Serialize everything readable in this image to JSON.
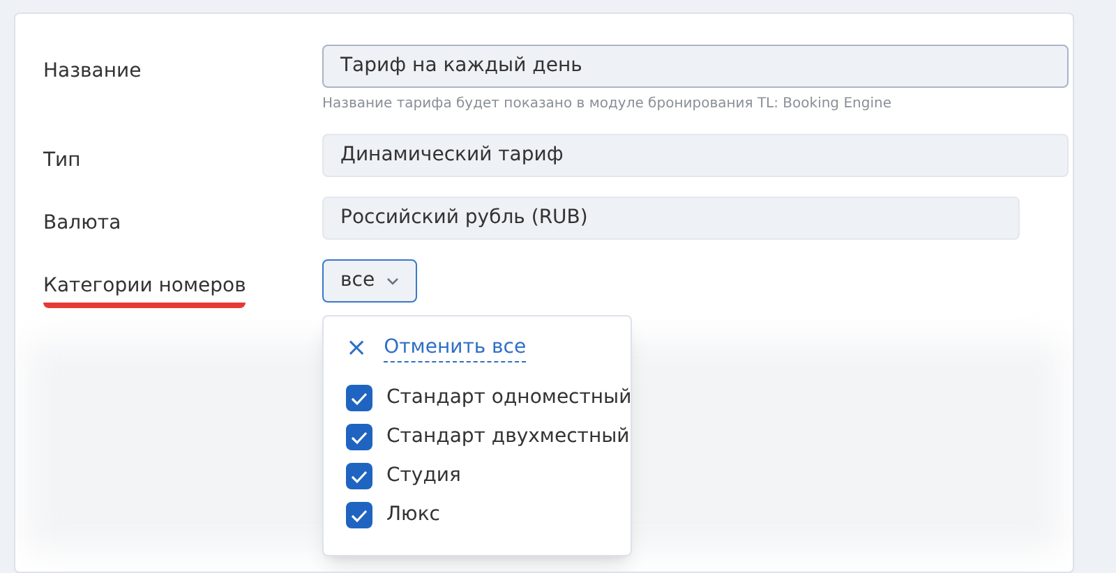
{
  "fields": [
    {
      "kind": "text",
      "label": "Название",
      "value": "Тариф на каждый день",
      "hint": "Название тарифа будет показано в модуле бронирования TL: Booking Engine",
      "focused": true
    },
    {
      "kind": "readonly",
      "label": "Тип",
      "value": "Динамический тариф"
    },
    {
      "kind": "readonly_short",
      "label": "Валюта",
      "value": "Российский рубль (RUB)"
    },
    {
      "kind": "select",
      "label": "Категории номеров",
      "value": "все",
      "highlighted": true
    }
  ],
  "dropdown": {
    "clear_icon": "×",
    "clear_label": "Отменить все",
    "options": [
      {
        "label": "Стандарт одноместный",
        "checked": true
      },
      {
        "label": "Стандарт двухместный",
        "checked": true
      },
      {
        "label": "Студия",
        "checked": true
      },
      {
        "label": "Люкс",
        "checked": true
      }
    ]
  }
}
